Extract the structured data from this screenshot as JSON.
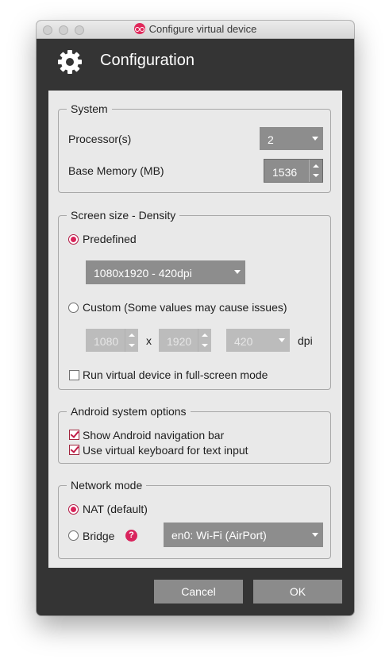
{
  "window": {
    "title": "Configure virtual device",
    "header": "Configuration"
  },
  "system": {
    "legend": "System",
    "processor_label": "Processor(s)",
    "processor_value": "2",
    "memory_label": "Base Memory (MB)",
    "memory_value": "1536"
  },
  "screen": {
    "legend": "Screen size - Density",
    "predefined_label": "Predefined",
    "predefined_value": "1080x1920 - 420dpi",
    "custom_label": "Custom (Some values may cause issues)",
    "width": "1080",
    "x_sep": "x",
    "height": "1920",
    "density": "420",
    "dpi_label": "dpi",
    "fullscreen_label": "Run virtual device in full-screen mode"
  },
  "android": {
    "legend": "Android system options",
    "navbar_label": "Show Android navigation bar",
    "keyboard_label": "Use virtual keyboard for text input"
  },
  "network": {
    "legend": "Network mode",
    "nat_label": "NAT (default)",
    "bridge_label": "Bridge",
    "help_glyph": "?",
    "interface_value": "en0: Wi-Fi (AirPort)"
  },
  "buttons": {
    "cancel": "Cancel",
    "ok": "OK"
  },
  "colors": {
    "accent": "#d8245a",
    "chrome": "#343434",
    "panel": "#e9e9e9",
    "control": "#8d8d8d"
  }
}
